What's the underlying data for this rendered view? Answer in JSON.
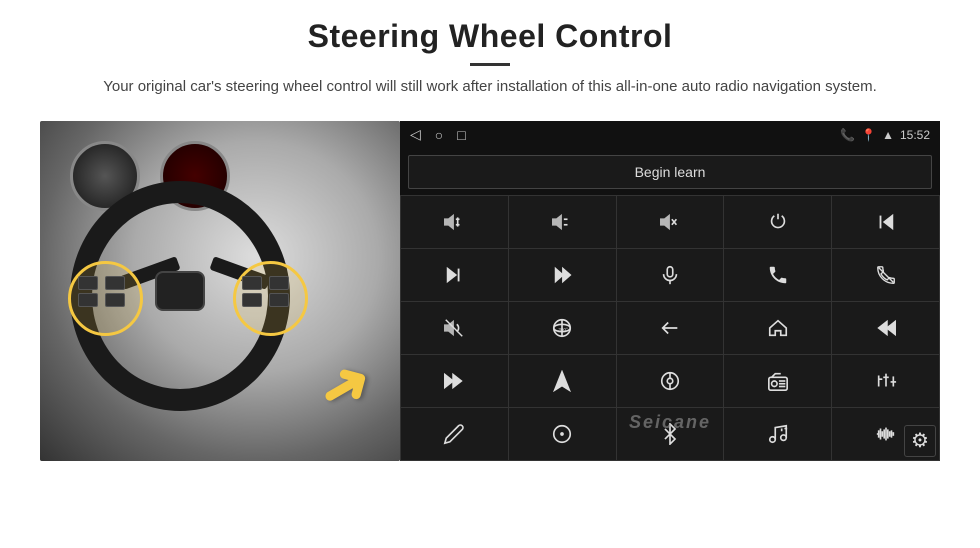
{
  "page": {
    "title": "Steering Wheel Control",
    "divider": true,
    "subtitle": "Your original car's steering wheel control will still work after installation of this all-in-one auto radio navigation system."
  },
  "status_bar": {
    "time": "15:52",
    "nav_icons": [
      "◁",
      "○",
      "□"
    ]
  },
  "begin_learn_button": "Begin learn",
  "icon_rows": [
    [
      "vol+",
      "vol-",
      "mute",
      "power",
      "prev-track"
    ],
    [
      "next",
      "skip-fwd",
      "mic",
      "phone",
      "hangup"
    ],
    [
      "speaker",
      "360cam",
      "back",
      "home",
      "rewind"
    ],
    [
      "fast-fwd",
      "navigate",
      "source",
      "radio",
      "equalizer"
    ],
    [
      "pen",
      "settings-dot",
      "bluetooth",
      "music-settings",
      "waveform"
    ]
  ],
  "watermark": "Seicane",
  "gear_icon": "⚙"
}
